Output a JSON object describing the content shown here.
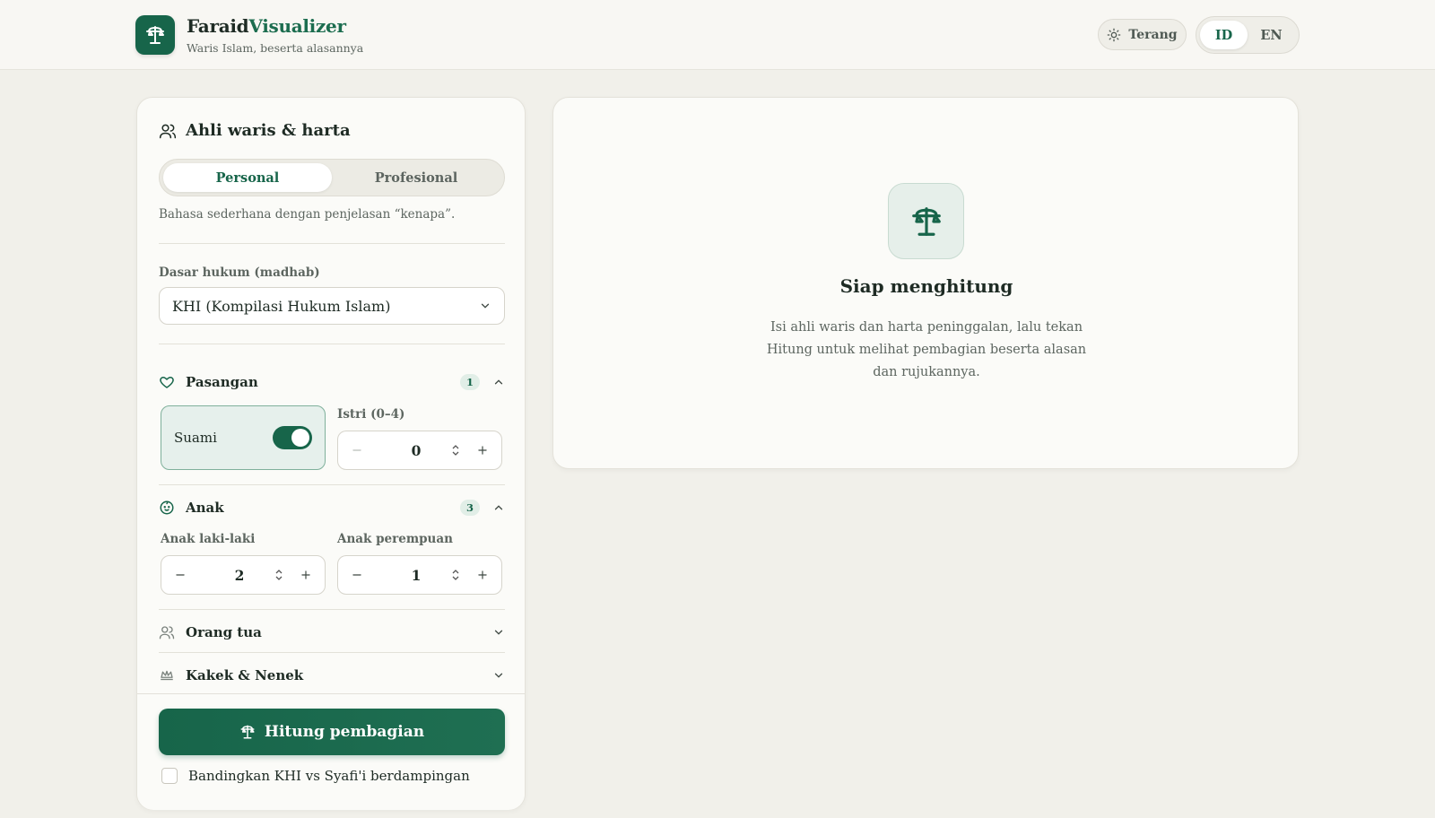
{
  "header": {
    "brand_part1": "Faraid",
    "brand_part2": "Visualizer",
    "subtitle": "Waris Islam, beserta alasannya",
    "theme_label": "Terang",
    "lang_options": [
      "ID",
      "EN"
    ],
    "lang_active": "ID"
  },
  "form": {
    "title": "Ahli waris & harta",
    "modes": [
      "Personal",
      "Profesional"
    ],
    "active_mode": "Personal",
    "mode_description": "Bahasa sederhana dengan penjelasan “kenapa”.",
    "madhab_label": "Dasar hukum (madhab)",
    "madhab_value": "KHI (Kompilasi Hukum Islam)",
    "sections": {
      "pasangan": {
        "title": "Pasangan",
        "count": "1",
        "suami_label": "Suami",
        "suami_on": true,
        "istri_label": "Istri (0–4)",
        "istri_value": "0"
      },
      "anak": {
        "title": "Anak",
        "count": "3",
        "laki_label": "Anak laki-laki",
        "laki_value": "2",
        "perempuan_label": "Anak perempuan",
        "perempuan_value": "1"
      },
      "orang_tua": {
        "title": "Orang tua"
      },
      "kakek_nenek": {
        "title": "Kakek & Nenek"
      }
    },
    "submit_label": "Hitung pembagian",
    "compare_label": "Bandingkan KHI vs Syafi'i berdampingan"
  },
  "result": {
    "title": "Siap menghitung",
    "description": "Isi ahli waris dan harta peninggalan, lalu tekan Hitung untuk melihat pembagian beserta alasan dan rujukannya."
  },
  "colors": {
    "primary": "#17654a",
    "background": "#f1f0ea",
    "card": "#fbfbf8"
  },
  "icons": {
    "logo": "scale-icon",
    "theme": "sun-icon",
    "form_head": "users-icon",
    "pasangan": "heart-icon",
    "anak": "baby-icon",
    "orang_tua": "users-icon",
    "kakek_nenek": "crown-icon"
  }
}
